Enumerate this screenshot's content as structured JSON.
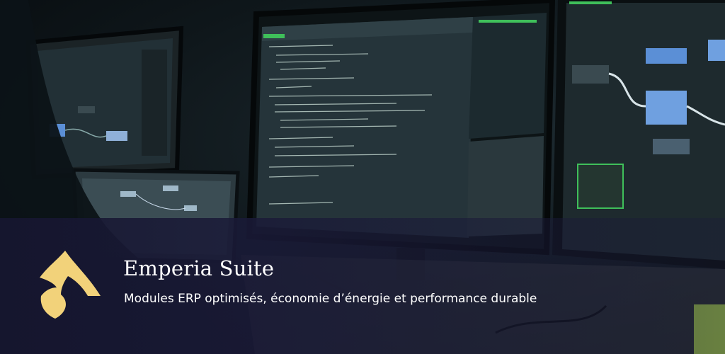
{
  "brand": {
    "title": "Emperia Suite",
    "tagline": "Modules ERP optimisés, économie d’énergie et performance durable",
    "logo_color": "#f2d27a",
    "banner_color": "#1a1a38"
  },
  "background": {
    "accent_green": "#3fbf5a",
    "node_blue": "#5b8fd6",
    "screen_dark": "#1e2a2e"
  }
}
